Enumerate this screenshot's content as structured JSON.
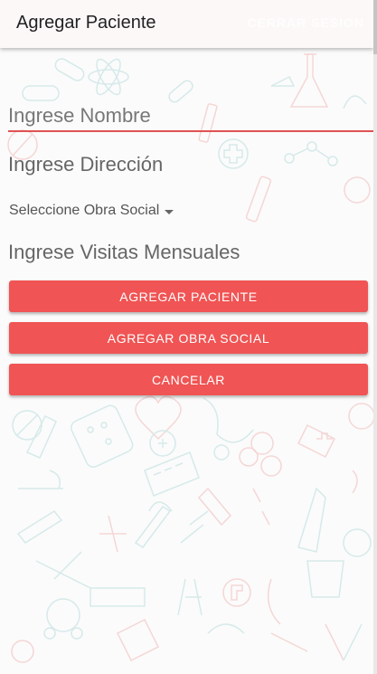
{
  "header": {
    "title": "Agregar Paciente",
    "logout_label": "CERRAR SESION"
  },
  "form": {
    "nombre_placeholder": "Ingrese Nombre",
    "direccion_placeholder": "Ingrese Dirección",
    "obra_social_label": "Seleccione Obra Social",
    "visitas_placeholder": "Ingrese Visitas Mensuales"
  },
  "buttons": {
    "agregar_paciente": "AGREGAR PACIENTE",
    "agregar_obra_social": "AGREGAR OBRA SOCIAL",
    "cancelar": "CANCELAR"
  },
  "colors": {
    "accent": "#f05454",
    "underline": "#e05252",
    "pattern_red": "#f1b9b9",
    "pattern_teal": "#b9dcdc"
  },
  "icons": [
    "molecule-icon",
    "pill-icon",
    "cross-icon",
    "flask-icon",
    "atom-icon",
    "syringe-icon",
    "microscope-icon",
    "heart-icon"
  ]
}
